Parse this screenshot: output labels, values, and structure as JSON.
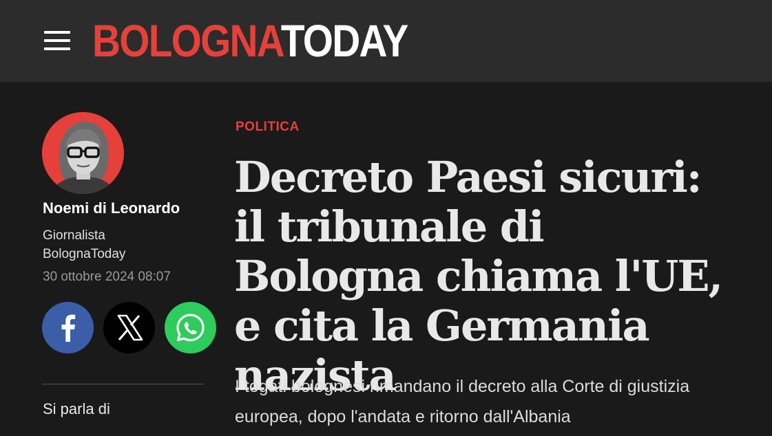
{
  "header": {
    "menu_icon": "hamburger-menu-icon",
    "logo_part1": "BOLOGNA",
    "logo_part2": "TODAY",
    "colors": {
      "brand_red": "#e6403a",
      "header_bg": "#2c2c2c",
      "page_bg": "#1a1a1a"
    }
  },
  "author": {
    "name": "Noemi di Leonardo",
    "role_line1": "Giornalista",
    "role_line2": "BolognaToday",
    "date": "30 ottobre 2024 08:07"
  },
  "share": {
    "facebook_icon": "facebook-icon",
    "x_icon": "x-icon",
    "whatsapp_icon": "whatsapp-icon"
  },
  "sidebar": {
    "topics_label": "Si parla di"
  },
  "article": {
    "category": "POLITICA",
    "headline": "Decreto Paesi sicuri: il tribunale di Bologna chiama l'UE, e cita la Germania nazista",
    "subtitle": "I togati bolognesi rimandano il decreto alla Corte di giustizia europea, dopo l'andata e ritorno dall'Albania"
  }
}
